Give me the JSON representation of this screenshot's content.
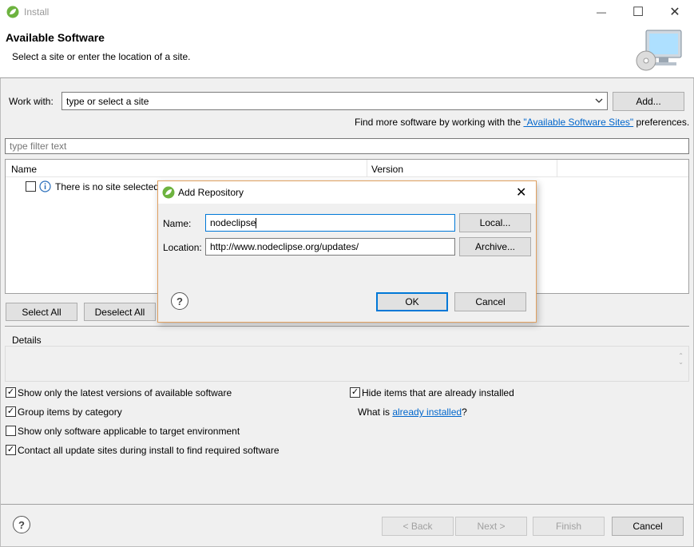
{
  "window": {
    "title": "Install",
    "minimize_glyph": "—",
    "maximize_glyph": "☐",
    "close_glyph": "✕"
  },
  "header": {
    "title": "Available Software",
    "subtitle": "Select a site or enter the location of a site."
  },
  "work_with": {
    "label": "Work with:",
    "placeholder": "type or select a site",
    "add_label": "Add...",
    "find_more_prefix": "Find more software by working with the ",
    "find_more_link": "\"Available Software Sites\"",
    "find_more_suffix": " preferences."
  },
  "filter": {
    "placeholder": "type filter text"
  },
  "table": {
    "columns": [
      "Name",
      "Version"
    ],
    "rows": [
      {
        "text": "There is no site selected."
      }
    ]
  },
  "selection_buttons": {
    "select_all": "Select All",
    "deselect_all": "Deselect All"
  },
  "details": {
    "label": "Details"
  },
  "options": {
    "latest_versions": {
      "label": "Show only the latest versions of available software",
      "checked": true
    },
    "group_by_category": {
      "label": "Group items by category",
      "checked": true
    },
    "applicable_only": {
      "label": "Show only software applicable to target environment",
      "checked": false
    },
    "contact_sites": {
      "label": "Contact all update sites during install to find required software",
      "checked": true
    },
    "hide_installed": {
      "label": "Hide items that are already installed",
      "checked": true
    },
    "what_is_prefix": "What is ",
    "what_is_link": "already installed",
    "what_is_suffix": "?"
  },
  "footer": {
    "back": "< Back",
    "next": "Next >",
    "finish": "Finish",
    "cancel": "Cancel"
  },
  "dialog": {
    "title": "Add Repository",
    "name_label": "Name:",
    "name_value": "nodeclipse",
    "location_label": "Location:",
    "location_value": "http://www.nodeclipse.org/updates/",
    "local_button": "Local...",
    "archive_button": "Archive...",
    "ok": "OK",
    "cancel": "Cancel"
  },
  "colors": {
    "accent": "#0078d7",
    "link": "#0066cc",
    "dialog_border": "#e0a060",
    "spring_green": "#6db33f"
  }
}
